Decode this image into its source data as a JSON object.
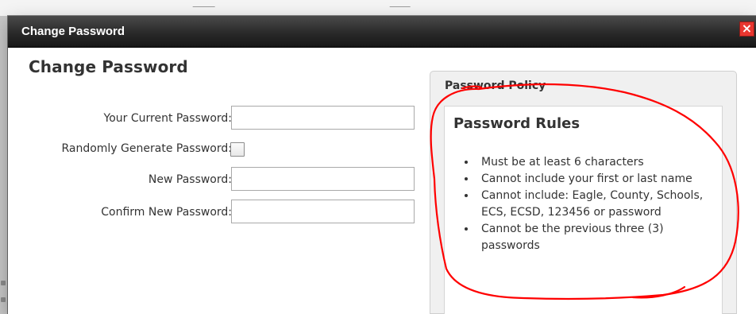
{
  "dialog": {
    "title": "Change Password"
  },
  "form": {
    "heading": "Change Password",
    "fields": {
      "current": {
        "label": "Your Current Password:",
        "value": ""
      },
      "random": {
        "label": "Randomly Generate Password:",
        "checked": false
      },
      "new": {
        "label": "New Password:",
        "value": ""
      },
      "confirm": {
        "label": "Confirm New Password:",
        "value": ""
      }
    }
  },
  "policy": {
    "header": "Password Policy",
    "rules_title": "Password Rules",
    "rules": [
      "Must be at least 6 characters",
      "Cannot include your first or last name",
      "Cannot include: Eagle, County, Schools, ECS, ECSD, 123456 or password",
      "Cannot be the previous three (3) passwords"
    ]
  },
  "icons": {
    "close": "close-icon"
  },
  "colors": {
    "dialog_title_bar": "#232323",
    "close_button": "#e8362f",
    "annotation_stroke": "#ff0000",
    "text": "#333333"
  }
}
